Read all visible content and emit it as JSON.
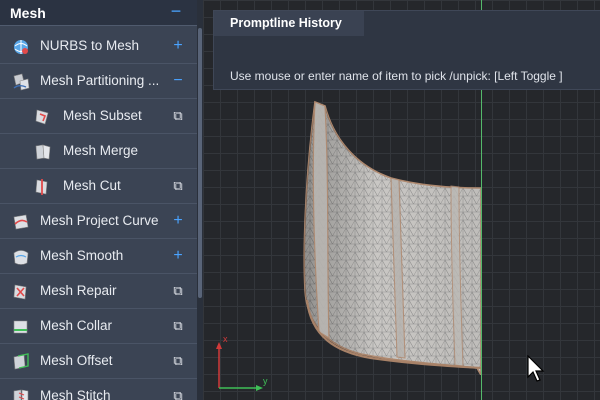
{
  "panel": {
    "title": "Mesh",
    "collapse_glyph": "−",
    "items": [
      {
        "label": "NURBS to Mesh",
        "icon": "nurbs-to-mesh-icon",
        "action": "+",
        "action_name": "expand-icon",
        "level": 0
      },
      {
        "label": "Mesh Partitioning ...",
        "icon": "mesh-partitioning-icon",
        "action": "−",
        "action_name": "collapse-icon",
        "level": 0
      },
      {
        "label": "Mesh Subset",
        "icon": "mesh-subset-icon",
        "action": "⧉",
        "action_name": "popout-icon",
        "level": 1
      },
      {
        "label": "Mesh Merge",
        "icon": "mesh-merge-icon",
        "action": "",
        "action_name": "",
        "level": 1
      },
      {
        "label": "Mesh Cut",
        "icon": "mesh-cut-icon",
        "action": "⧉",
        "action_name": "popout-icon",
        "level": 1
      },
      {
        "label": "Mesh Project Curve",
        "icon": "mesh-project-curve-icon",
        "action": "+",
        "action_name": "expand-icon",
        "level": 0
      },
      {
        "label": "Mesh Smooth",
        "icon": "mesh-smooth-icon",
        "action": "+",
        "action_name": "expand-icon",
        "level": 0
      },
      {
        "label": "Mesh Repair",
        "icon": "mesh-repair-icon",
        "action": "⧉",
        "action_name": "popout-icon",
        "level": 0
      },
      {
        "label": "Mesh Collar",
        "icon": "mesh-collar-icon",
        "action": "⧉",
        "action_name": "popout-icon",
        "level": 0
      },
      {
        "label": "Mesh Offset",
        "icon": "mesh-offset-icon",
        "action": "⧉",
        "action_name": "popout-icon",
        "level": 0
      },
      {
        "label": "Mesh Stitch",
        "icon": "mesh-stitch-icon",
        "action": "⧉",
        "action_name": "popout-icon",
        "level": 0
      }
    ]
  },
  "history": {
    "title": "Promptline History",
    "text": "Use mouse or enter name of item to pick /unpick: [Left Toggle ]"
  },
  "triad": {
    "x_label": "x",
    "y_label": "y"
  },
  "colors": {
    "accent": "#4aa3ff",
    "panel_bg": "#3b4454",
    "viewport_bg": "#25272b",
    "axis_x": "#d23a3a",
    "axis_y": "#3fbf57",
    "mesh_fill": "#c9c7c4",
    "mesh_edge": "#b08a70"
  }
}
